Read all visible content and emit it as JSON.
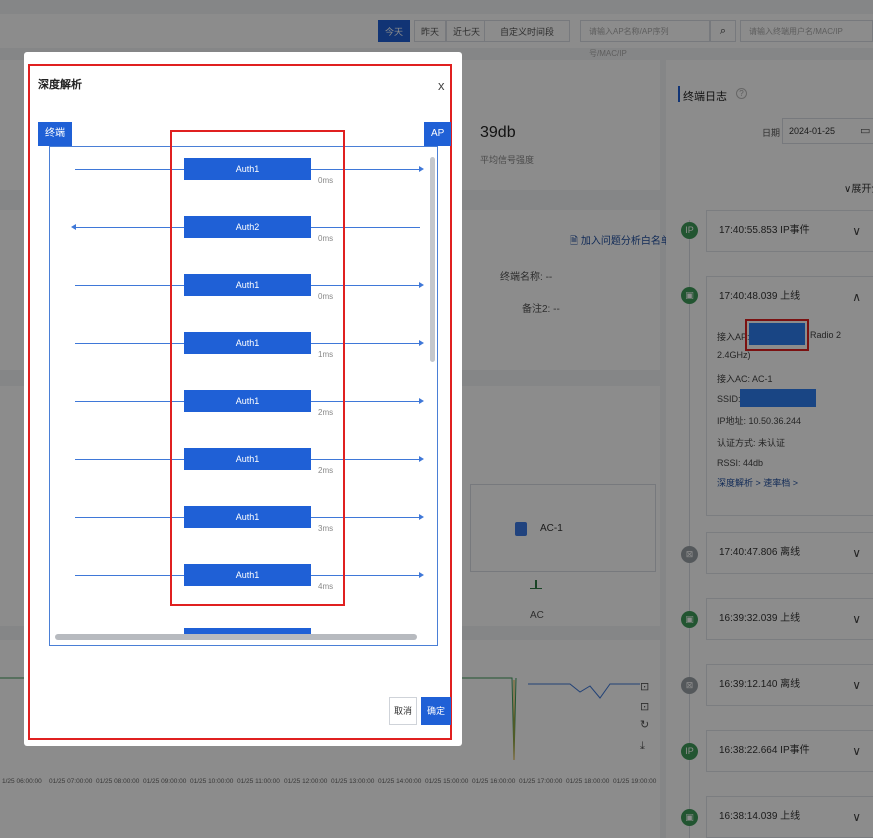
{
  "topbar": {
    "chips": [
      "今天",
      "昨天",
      "近七天",
      "自定义时间段"
    ],
    "ap_search_placeholder": "请输入AP名称/AP序列号/MAC/IP",
    "user_search_placeholder": "请输入终端用户名/MAC/IP"
  },
  "metric": {
    "value": "39db",
    "label": "平均信号强度"
  },
  "info_card": {
    "add_link": "加入问题分析白名单",
    "terminal_name_label": "终端名称:",
    "terminal_name_value": "--",
    "remark_label": "备注2:",
    "remark_value": "--"
  },
  "topology": {
    "ac_name": "AC-1",
    "ac_label": "AC"
  },
  "timeline_ticks": [
    "1/25 06:00:00",
    "01/25 07:00:00",
    "01/25 08:00:00",
    "01/25 09:00:00",
    "01/25 10:00:00",
    "01/25 11:00:00",
    "01/25 12:00:00",
    "01/25 13:00:00",
    "01/25 14:00:00",
    "01/25 15:00:00",
    "01/25 16:00:00",
    "01/25 17:00:00",
    "01/25 18:00:00",
    "01/25 19:00:00"
  ],
  "log_panel": {
    "title": "终端日志",
    "date_label": "日期",
    "date_value": "2024-01-25",
    "expand_all": "∨展开全",
    "items": [
      {
        "time": "17:40:55.853",
        "event": "IP事件"
      },
      {
        "time": "17:40:48.039",
        "event": "上线"
      },
      {
        "time": "17:40:47.806",
        "event": "离线"
      },
      {
        "time": "16:39:32.039",
        "event": "上线"
      },
      {
        "time": "16:39:12.140",
        "event": "离线"
      },
      {
        "time": "16:38:22.664",
        "event": "IP事件"
      },
      {
        "time": "16:38:14.039",
        "event": "上线"
      }
    ],
    "detail": {
      "ap_label": "接入AP:",
      "radio": "Radio 2",
      "band": "2.4GHz)",
      "ac_line": "接入AC:  AC-1",
      "ssid_label": "SSID:",
      "ip_line": "IP地址:  10.50.36.244",
      "auth_line": "认证方式:  未认证",
      "rssi_line": "RSSI:  44db",
      "deep_link": "深度解析 > 速率档 >"
    }
  },
  "modal": {
    "title": "深度解析",
    "close": "x",
    "left_tag": "终端",
    "right_tag": "AP",
    "flows": [
      {
        "label": "Auth1",
        "time": "0ms",
        "dir": "right"
      },
      {
        "label": "Auth2",
        "time": "0ms",
        "dir": "left"
      },
      {
        "label": "Auth1",
        "time": "0ms",
        "dir": "right"
      },
      {
        "label": "Auth1",
        "time": "1ms",
        "dir": "right"
      },
      {
        "label": "Auth1",
        "time": "2ms",
        "dir": "right"
      },
      {
        "label": "Auth1",
        "time": "2ms",
        "dir": "right"
      },
      {
        "label": "Auth1",
        "time": "3ms",
        "dir": "right"
      },
      {
        "label": "Auth1",
        "time": "4ms",
        "dir": "right"
      }
    ],
    "cancel": "取消",
    "ok": "确定"
  },
  "colors": {
    "accent": "#1f60d6",
    "highlight_frame": "#e02020",
    "log_node_green": "#3f9b5a"
  }
}
